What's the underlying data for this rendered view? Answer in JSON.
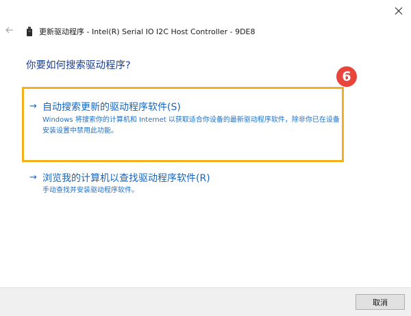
{
  "window": {
    "title": "更新驱动程序 - Intel(R) Serial IO I2C Host Controller - 9DE8",
    "close_icon": "close-icon",
    "back_icon": "back-arrow-icon",
    "device_icon": "usb-device-icon"
  },
  "main": {
    "heading": "你要如何搜索驱动程序?",
    "options": [
      {
        "arrow": "→",
        "title": "自动搜索更新的驱动程序软件(S)",
        "description": "Windows 将搜索你的计算机和 Internet 以获取适合你设备的最新驱动程序软件，除非你已在设备安装设置中禁用此功能。"
      },
      {
        "arrow": "→",
        "title": "浏览我的计算机以查找驱动程序软件(R)",
        "description": "手动查找并安装驱动程序软件。"
      }
    ],
    "step_badge": "6"
  },
  "footer": {
    "cancel_label": "取消"
  },
  "colors": {
    "link": "#1565c0",
    "heading": "#1c3f94",
    "highlight_border": "#f2b11c",
    "badge": "#e8463c",
    "footer_bg": "#f0f0f0"
  }
}
